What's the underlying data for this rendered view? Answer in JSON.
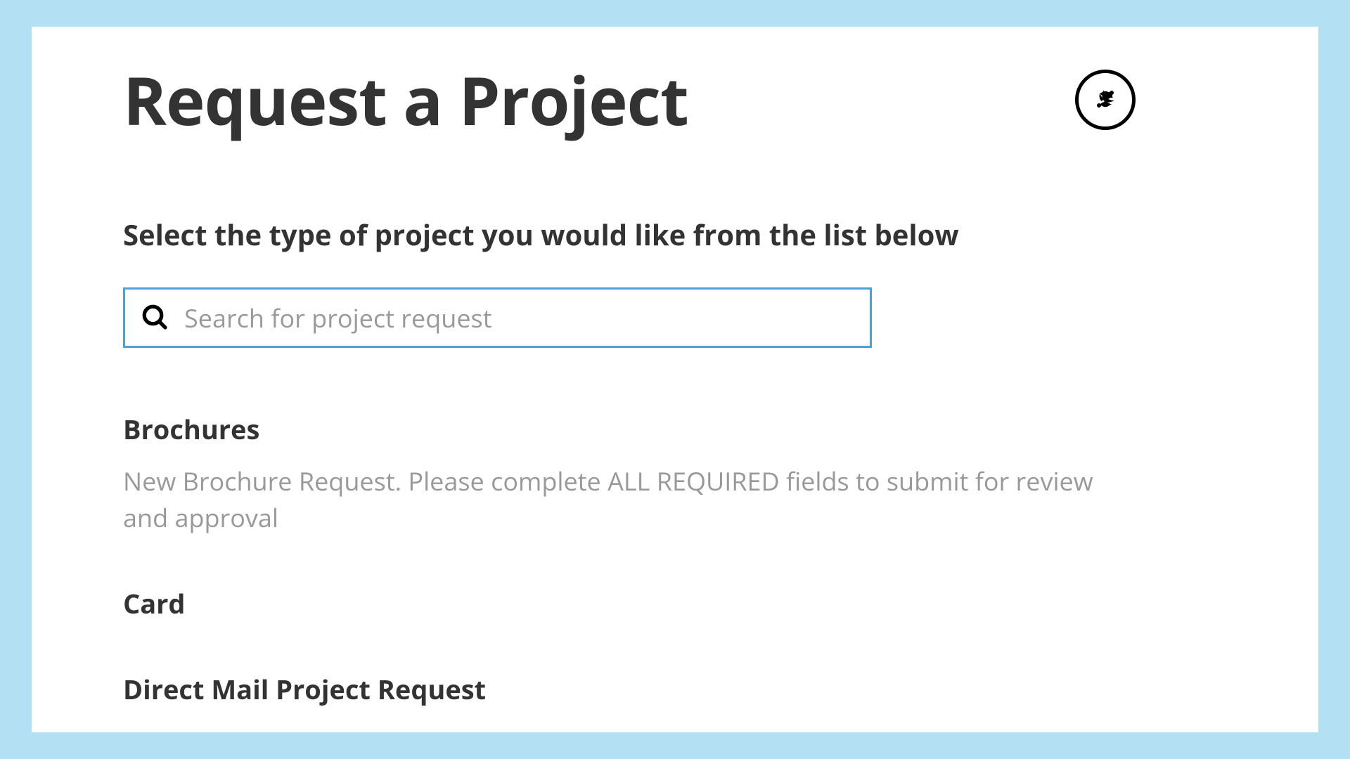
{
  "header": {
    "title": "Request a Project"
  },
  "subtitle": "Select the type of project you would like from the list below",
  "search": {
    "placeholder": "Search for project request",
    "value": ""
  },
  "items": [
    {
      "title": "Brochures",
      "description": "New Brochure Request. Please complete ALL REQUIRED fields to submit for review and approval"
    },
    {
      "title": "Card",
      "description": ""
    },
    {
      "title": "Direct Mail Project Request",
      "description": ""
    }
  ]
}
